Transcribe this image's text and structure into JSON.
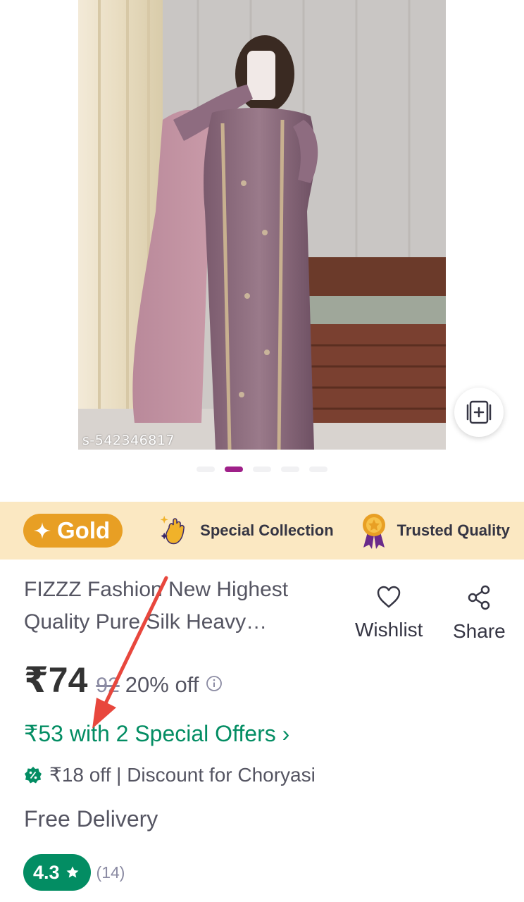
{
  "product_image": {
    "watermark": "s-542346817",
    "alt": "Woman in mauve embroidered silk kurta set with dupatta",
    "carousel_total": 5,
    "carousel_active": 2,
    "add_collection_icon": "add-to-collection-icon"
  },
  "badges": {
    "gold_label": "Gold",
    "gold_icon": "sparkle-icon",
    "special_collection_label": "Special Collection",
    "special_collection_icon": "hand-sparkle-icon",
    "trusted_quality_label": "Trusted Quality",
    "trusted_quality_icon": "medal-icon"
  },
  "product": {
    "title": "FIZZZ Fashion New Highest Quality Pure Silk Heavy Embroidered Kurta Set",
    "price": "₹74",
    "mrp": "92",
    "discount": "20% off",
    "special_offers": "₹53 with 2 Special Offers ›",
    "coupon": "₹18 off | Discount for Choryasi",
    "delivery": "Free Delivery",
    "rating": "4.3",
    "rating_count": "(14)"
  },
  "actions": {
    "wishlist_label": "Wishlist",
    "wishlist_icon": "heart-icon",
    "share_label": "Share",
    "share_icon": "share-icon"
  },
  "colors": {
    "brand_purple": "#9f2089",
    "gold": "#e89f24",
    "badge_bar": "#fbe8c2",
    "offer_green": "#038d63",
    "annotation_red": "#e8473d"
  }
}
